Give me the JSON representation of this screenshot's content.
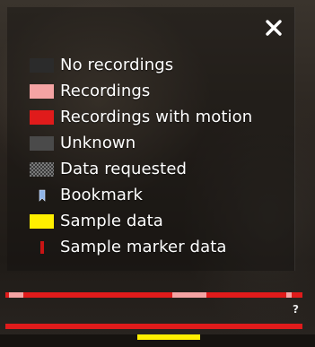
{
  "legend": {
    "close_icon": "close-icon",
    "items": [
      {
        "label": "No recordings",
        "color": "#2b2b2b",
        "swatch": "solid"
      },
      {
        "label": "Recordings",
        "color": "#f4a3a3",
        "swatch": "solid"
      },
      {
        "label": "Recordings with motion",
        "color": "#e01b1b",
        "swatch": "solid"
      },
      {
        "label": "Unknown",
        "color": "#4a4a4a",
        "swatch": "solid"
      },
      {
        "label": "Data requested",
        "color": "#6a6a6a",
        "swatch": "checker"
      },
      {
        "label": "Bookmark",
        "color": "#8fb4e8",
        "swatch": "bookmark-icon"
      },
      {
        "label": "Sample data",
        "color": "#ffef00",
        "swatch": "solid"
      },
      {
        "label": "Sample marker data",
        "color": "#c81414",
        "swatch": "marker-icon"
      }
    ]
  },
  "timeline": {
    "help_label": "?",
    "colors": {
      "motion": "#e01b1b",
      "recording": "#f4a3a3",
      "sample": "#ffef00",
      "background": "#161310"
    }
  }
}
